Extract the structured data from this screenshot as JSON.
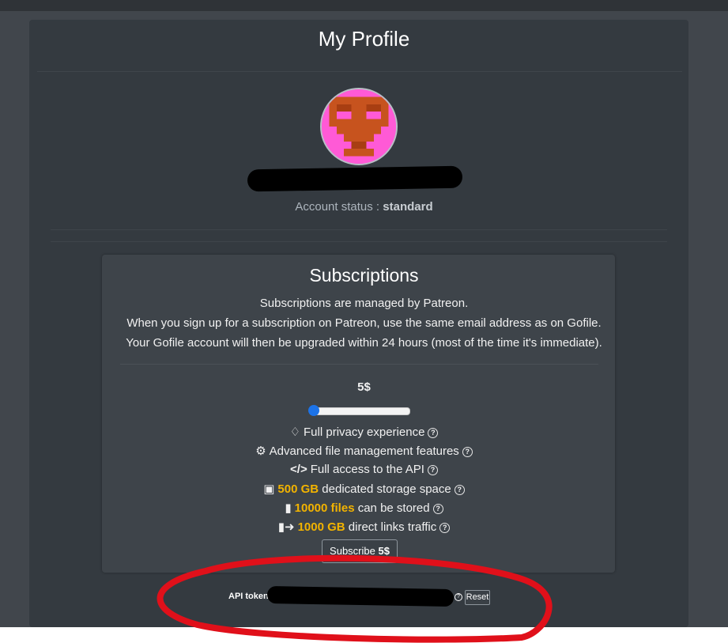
{
  "profile": {
    "title": "My Profile",
    "status_label": "Account status :",
    "status_value": "standard"
  },
  "subscriptions": {
    "title": "Subscriptions",
    "desc": [
      "Subscriptions are managed by Patreon.",
      "When you sign up for a subscription on Patreon, use the same email address as on Gofile.",
      "Your Gofile account will then be upgraded within 24 hours (most of the time it's immediate)."
    ],
    "price": "5$",
    "slider_level": 0,
    "features": [
      {
        "icon": "spy-icon",
        "highlight": "",
        "text": "Full privacy experience"
      },
      {
        "icon": "gear-icon",
        "highlight": "",
        "text": "Advanced file management features"
      },
      {
        "icon": "code-icon",
        "highlight": "",
        "text": "Full access to the API"
      },
      {
        "icon": "hdd-icon",
        "highlight": "500 GB",
        "text": "dedicated storage space"
      },
      {
        "icon": "file-icon",
        "highlight": "10000 files",
        "text": "can be stored"
      },
      {
        "icon": "file-export-icon",
        "highlight": "1000 GB",
        "text": "direct links traffic"
      }
    ],
    "subscribe_label": "Subscribe",
    "subscribe_price": "5$"
  },
  "api": {
    "label": "API token",
    "reset_label": "Reset"
  },
  "colors": {
    "highlight": "#f2b300",
    "slider_thumb": "#1c73e8",
    "annotation": "#e0101a"
  }
}
